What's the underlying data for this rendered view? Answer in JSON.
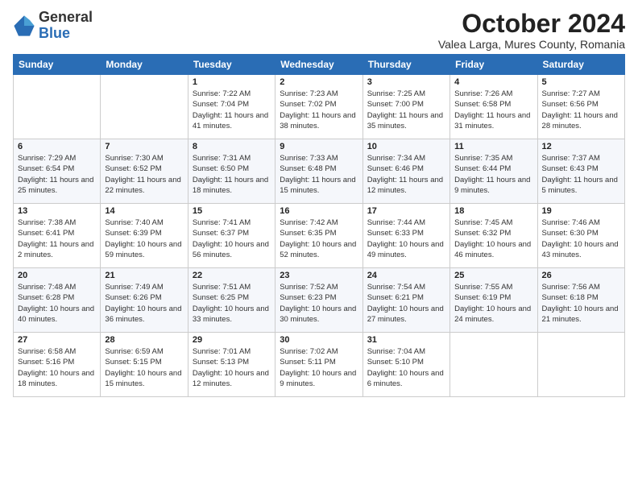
{
  "logo": {
    "general": "General",
    "blue": "Blue"
  },
  "header": {
    "month_title": "October 2024",
    "location": "Valea Larga, Mures County, Romania"
  },
  "weekdays": [
    "Sunday",
    "Monday",
    "Tuesday",
    "Wednesday",
    "Thursday",
    "Friday",
    "Saturday"
  ],
  "weeks": [
    [
      {
        "day": "",
        "info": ""
      },
      {
        "day": "",
        "info": ""
      },
      {
        "day": "1",
        "info": "Sunrise: 7:22 AM\nSunset: 7:04 PM\nDaylight: 11 hours\nand 41 minutes."
      },
      {
        "day": "2",
        "info": "Sunrise: 7:23 AM\nSunset: 7:02 PM\nDaylight: 11 hours\nand 38 minutes."
      },
      {
        "day": "3",
        "info": "Sunrise: 7:25 AM\nSunset: 7:00 PM\nDaylight: 11 hours\nand 35 minutes."
      },
      {
        "day": "4",
        "info": "Sunrise: 7:26 AM\nSunset: 6:58 PM\nDaylight: 11 hours\nand 31 minutes."
      },
      {
        "day": "5",
        "info": "Sunrise: 7:27 AM\nSunset: 6:56 PM\nDaylight: 11 hours\nand 28 minutes."
      }
    ],
    [
      {
        "day": "6",
        "info": "Sunrise: 7:29 AM\nSunset: 6:54 PM\nDaylight: 11 hours\nand 25 minutes."
      },
      {
        "day": "7",
        "info": "Sunrise: 7:30 AM\nSunset: 6:52 PM\nDaylight: 11 hours\nand 22 minutes."
      },
      {
        "day": "8",
        "info": "Sunrise: 7:31 AM\nSunset: 6:50 PM\nDaylight: 11 hours\nand 18 minutes."
      },
      {
        "day": "9",
        "info": "Sunrise: 7:33 AM\nSunset: 6:48 PM\nDaylight: 11 hours\nand 15 minutes."
      },
      {
        "day": "10",
        "info": "Sunrise: 7:34 AM\nSunset: 6:46 PM\nDaylight: 11 hours\nand 12 minutes."
      },
      {
        "day": "11",
        "info": "Sunrise: 7:35 AM\nSunset: 6:44 PM\nDaylight: 11 hours\nand 9 minutes."
      },
      {
        "day": "12",
        "info": "Sunrise: 7:37 AM\nSunset: 6:43 PM\nDaylight: 11 hours\nand 5 minutes."
      }
    ],
    [
      {
        "day": "13",
        "info": "Sunrise: 7:38 AM\nSunset: 6:41 PM\nDaylight: 11 hours\nand 2 minutes."
      },
      {
        "day": "14",
        "info": "Sunrise: 7:40 AM\nSunset: 6:39 PM\nDaylight: 10 hours\nand 59 minutes."
      },
      {
        "day": "15",
        "info": "Sunrise: 7:41 AM\nSunset: 6:37 PM\nDaylight: 10 hours\nand 56 minutes."
      },
      {
        "day": "16",
        "info": "Sunrise: 7:42 AM\nSunset: 6:35 PM\nDaylight: 10 hours\nand 52 minutes."
      },
      {
        "day": "17",
        "info": "Sunrise: 7:44 AM\nSunset: 6:33 PM\nDaylight: 10 hours\nand 49 minutes."
      },
      {
        "day": "18",
        "info": "Sunrise: 7:45 AM\nSunset: 6:32 PM\nDaylight: 10 hours\nand 46 minutes."
      },
      {
        "day": "19",
        "info": "Sunrise: 7:46 AM\nSunset: 6:30 PM\nDaylight: 10 hours\nand 43 minutes."
      }
    ],
    [
      {
        "day": "20",
        "info": "Sunrise: 7:48 AM\nSunset: 6:28 PM\nDaylight: 10 hours\nand 40 minutes."
      },
      {
        "day": "21",
        "info": "Sunrise: 7:49 AM\nSunset: 6:26 PM\nDaylight: 10 hours\nand 36 minutes."
      },
      {
        "day": "22",
        "info": "Sunrise: 7:51 AM\nSunset: 6:25 PM\nDaylight: 10 hours\nand 33 minutes."
      },
      {
        "day": "23",
        "info": "Sunrise: 7:52 AM\nSunset: 6:23 PM\nDaylight: 10 hours\nand 30 minutes."
      },
      {
        "day": "24",
        "info": "Sunrise: 7:54 AM\nSunset: 6:21 PM\nDaylight: 10 hours\nand 27 minutes."
      },
      {
        "day": "25",
        "info": "Sunrise: 7:55 AM\nSunset: 6:19 PM\nDaylight: 10 hours\nand 24 minutes."
      },
      {
        "day": "26",
        "info": "Sunrise: 7:56 AM\nSunset: 6:18 PM\nDaylight: 10 hours\nand 21 minutes."
      }
    ],
    [
      {
        "day": "27",
        "info": "Sunrise: 6:58 AM\nSunset: 5:16 PM\nDaylight: 10 hours\nand 18 minutes."
      },
      {
        "day": "28",
        "info": "Sunrise: 6:59 AM\nSunset: 5:15 PM\nDaylight: 10 hours\nand 15 minutes."
      },
      {
        "day": "29",
        "info": "Sunrise: 7:01 AM\nSunset: 5:13 PM\nDaylight: 10 hours\nand 12 minutes."
      },
      {
        "day": "30",
        "info": "Sunrise: 7:02 AM\nSunset: 5:11 PM\nDaylight: 10 hours\nand 9 minutes."
      },
      {
        "day": "31",
        "info": "Sunrise: 7:04 AM\nSunset: 5:10 PM\nDaylight: 10 hours\nand 6 minutes."
      },
      {
        "day": "",
        "info": ""
      },
      {
        "day": "",
        "info": ""
      }
    ]
  ]
}
